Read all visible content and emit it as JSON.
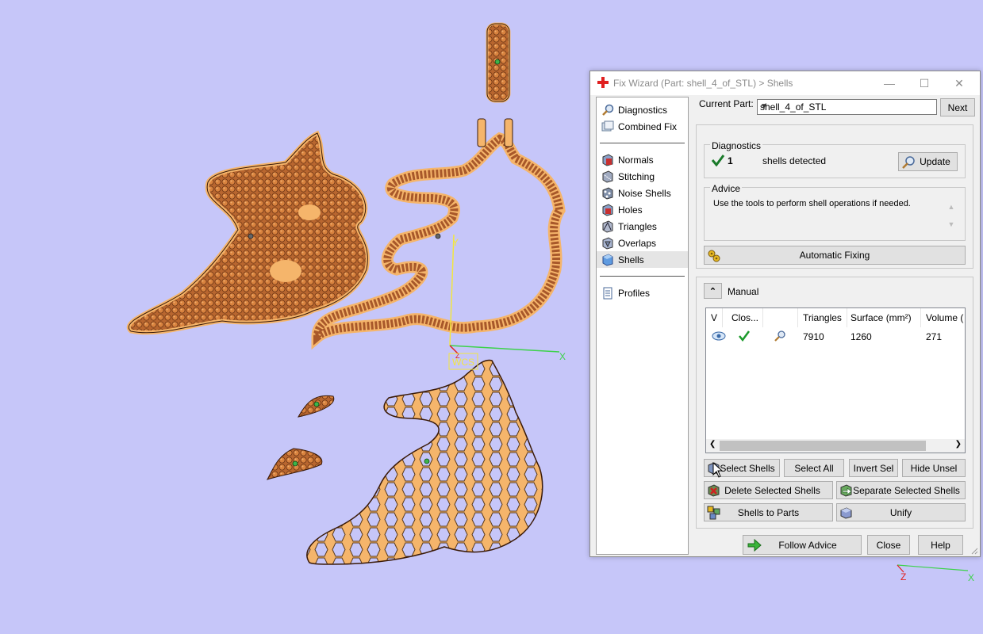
{
  "viewport": {
    "background": "#c6c6f9",
    "model_fill": "#f5b56b",
    "model_dark": "#a8582a",
    "axes": {
      "y": "Y",
      "x": "X",
      "z": "Z",
      "wcs": "WCS"
    },
    "corner_axes": {
      "x": "X",
      "z": "Z"
    }
  },
  "dialog": {
    "title": "Fix Wizard (Part: shell_4_of_STL) > Shells",
    "title_icon": "red-cross-icon",
    "window_buttons": {
      "minimize": "—",
      "maximize": "☐",
      "close": "✕"
    },
    "nav": {
      "top_items": [
        {
          "label": "Diagnostics",
          "icon": "magnifier-icon"
        },
        {
          "label": "Combined Fix",
          "icon": "layers-icon"
        }
      ],
      "tool_items": [
        {
          "label": "Normals",
          "icon": "normals-icon"
        },
        {
          "label": "Stitching",
          "icon": "stitching-icon"
        },
        {
          "label": "Noise Shells",
          "icon": "noise-shells-icon"
        },
        {
          "label": "Holes",
          "icon": "holes-icon"
        },
        {
          "label": "Triangles",
          "icon": "triangles-icon"
        },
        {
          "label": "Overlaps",
          "icon": "overlaps-icon"
        },
        {
          "label": "Shells",
          "icon": "shells-icon",
          "selected": true
        }
      ],
      "bottom_items": [
        {
          "label": "Profiles",
          "icon": "document-icon"
        }
      ]
    },
    "current_part": {
      "label": "Current Part:",
      "value": "shell_4_of_STL",
      "next_label": "Next"
    },
    "diagnostics": {
      "label": "Diagnostics",
      "count": "1",
      "status_text": "shells detected",
      "update_label": "Update"
    },
    "advice": {
      "label": "Advice",
      "text": "Use the tools to perform shell operations if needed."
    },
    "automatic_fixing_label": "Automatic Fixing",
    "manual": {
      "label": "Manual",
      "columns": [
        "V",
        "Clos...",
        "",
        "Triangles",
        "Surface (mm²)",
        "Volume ("
      ],
      "rows": [
        {
          "triangles": "7910",
          "surface": "1260",
          "volume": "271"
        }
      ],
      "buttons": {
        "select_shells": "Select Shells",
        "select_all": "Select All",
        "invert_sel": "Invert Sel",
        "hide_unsel": "Hide Unsel",
        "delete_selected": "Delete Selected Shells",
        "separate_selected": "Separate Selected Shells",
        "shells_to_parts": "Shells to Parts",
        "unify": "Unify"
      }
    },
    "footer": {
      "follow_advice": "Follow Advice",
      "close": "Close",
      "help": "Help"
    }
  }
}
